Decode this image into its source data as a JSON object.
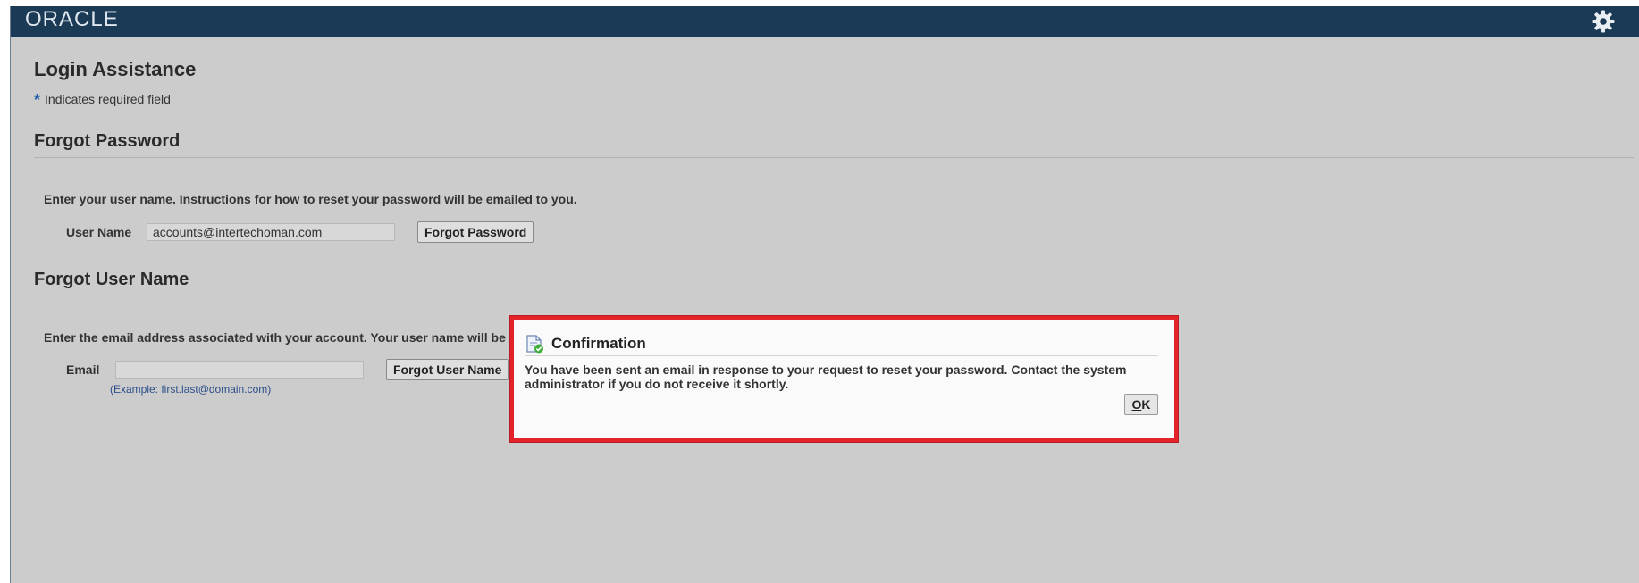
{
  "branding": {
    "logo_text": "ORACLE",
    "bar_color": "#1a3a56",
    "settings_icon": "gear-icon"
  },
  "page": {
    "title": "Login Assistance",
    "required_note": "Indicates required field",
    "required_mark": "*"
  },
  "forgot_password": {
    "title": "Forgot Password",
    "instructions": "Enter your user name. Instructions for how to reset your password will be emailed to you.",
    "username_label": "User Name",
    "username_value": "accounts@intertechoman.com",
    "button_label": "Forgot Password"
  },
  "forgot_username": {
    "title": "Forgot User Name",
    "instructions": "Enter the email address associated with your account. Your user name will be emailed to you.",
    "email_label": "Email",
    "email_value": "",
    "example": "(Example: first.last@domain.com)",
    "button_label": "Forgot User Name"
  },
  "dialog": {
    "title": "Confirmation",
    "icon": "confirmation-icon",
    "message": "You have been sent an email in response to your request to reset your password. Contact the system administrator if you do not receive it shortly.",
    "ok_accesskey": "O",
    "ok_rest": "K",
    "highlight_color": "#e3232a"
  }
}
